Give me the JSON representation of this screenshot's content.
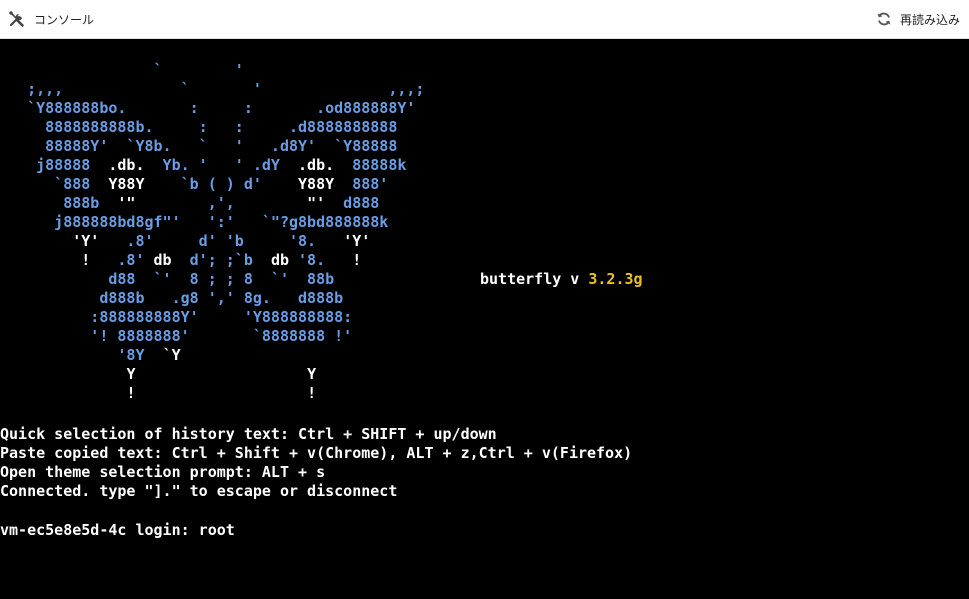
{
  "header": {
    "title": "コンソール",
    "reload_label": "再読み込み"
  },
  "icons": {
    "title_icon": "tools-icon",
    "reload_icon": "reload-icon"
  },
  "terminal": {
    "art_lines": [
      [
        {
          "t": "                 `        '",
          "c": "b"
        }
      ],
      [
        {
          "t": "   ;,,,             `       '              ,,,;",
          "c": "b"
        }
      ],
      [
        {
          "t": "   `Y888888bo.       :     :       .od888888Y'",
          "c": "b"
        }
      ],
      [
        {
          "t": "     8888888888b.     :   :     .d8888888888",
          "c": "b"
        }
      ],
      [
        {
          "t": "     88888Y'  `Y8b.   `   '   .d8Y'  `Y88888",
          "c": "b"
        }
      ],
      [
        {
          "t": "    j88888  ",
          "c": "b"
        },
        {
          "t": ".db.",
          "c": "w"
        },
        {
          "t": "  Yb. '   ' .dY  ",
          "c": "b"
        },
        {
          "t": ".db.",
          "c": "w"
        },
        {
          "t": "  88888k",
          "c": "b"
        }
      ],
      [
        {
          "t": "      `888  ",
          "c": "b"
        },
        {
          "t": "Y88Y",
          "c": "w"
        },
        {
          "t": "    `b ( ) d'    ",
          "c": "b"
        },
        {
          "t": "Y88Y",
          "c": "w"
        },
        {
          "t": "  888'",
          "c": "b"
        }
      ],
      [
        {
          "t": "       888b  ",
          "c": "b"
        },
        {
          "t": "'\"",
          "c": "w"
        },
        {
          "t": "        ,',        ",
          "c": "b"
        },
        {
          "t": "\"'",
          "c": "w"
        },
        {
          "t": "  d888",
          "c": "b"
        }
      ],
      [
        {
          "t": "      j888888bd8gf\"'   ':'   `\"?g8bd888888k",
          "c": "b"
        }
      ],
      [
        {
          "t": "        ",
          "c": "b"
        },
        {
          "t": "'Y'",
          "c": "w"
        },
        {
          "t": "   .8'     d' 'b     '8.   ",
          "c": "b"
        },
        {
          "t": "'Y'",
          "c": "w"
        }
      ],
      [
        {
          "t": "         ",
          "c": "b"
        },
        {
          "t": "!",
          "c": "w"
        },
        {
          "t": "   .8' ",
          "c": "b"
        },
        {
          "t": "db",
          "c": "w"
        },
        {
          "t": "  d'; ;`b  ",
          "c": "b"
        },
        {
          "t": "db",
          "c": "w"
        },
        {
          "t": " '8.   ",
          "c": "b"
        },
        {
          "t": "!",
          "c": "w"
        }
      ],
      [
        {
          "t": "            d88  `'  8 ; ; 8  `'  88b",
          "c": "b"
        }
      ],
      [
        {
          "t": "           d888b   .g8 ',' 8g.   d888b",
          "c": "b"
        }
      ],
      [
        {
          "t": "          :888888888Y'     'Y888888888:",
          "c": "b"
        }
      ],
      [
        {
          "t": "          '! 8888888'       `8888888 !'",
          "c": "b"
        }
      ],
      [
        {
          "t": "             '8Y  ",
          "c": "b"
        },
        {
          "t": "`Y",
          "c": "w"
        }
      ],
      [
        {
          "t": "              ",
          "c": "b"
        },
        {
          "t": "Y",
          "c": "w"
        },
        {
          "t": "                   ",
          "c": "b"
        },
        {
          "t": "Y",
          "c": "w"
        }
      ],
      [
        {
          "t": "              ",
          "c": "b"
        },
        {
          "t": "!",
          "c": "w"
        },
        {
          "t": "                   ",
          "c": "b"
        },
        {
          "t": "!",
          "c": "w"
        }
      ]
    ],
    "banner_name": "butterfly v ",
    "banner_version": "3.2.3g",
    "messages": [
      "Quick selection of history text: Ctrl + SHIFT + up/down",
      "Paste copied text: Ctrl + Shift + v(Chrome), ALT + z,Ctrl + v(Firefox)",
      "Open theme selection prompt: ALT + s",
      "Connected. type \"].\" to escape or disconnect"
    ],
    "login_prompt": "vm-ec5e8e5d-4c login: root"
  }
}
